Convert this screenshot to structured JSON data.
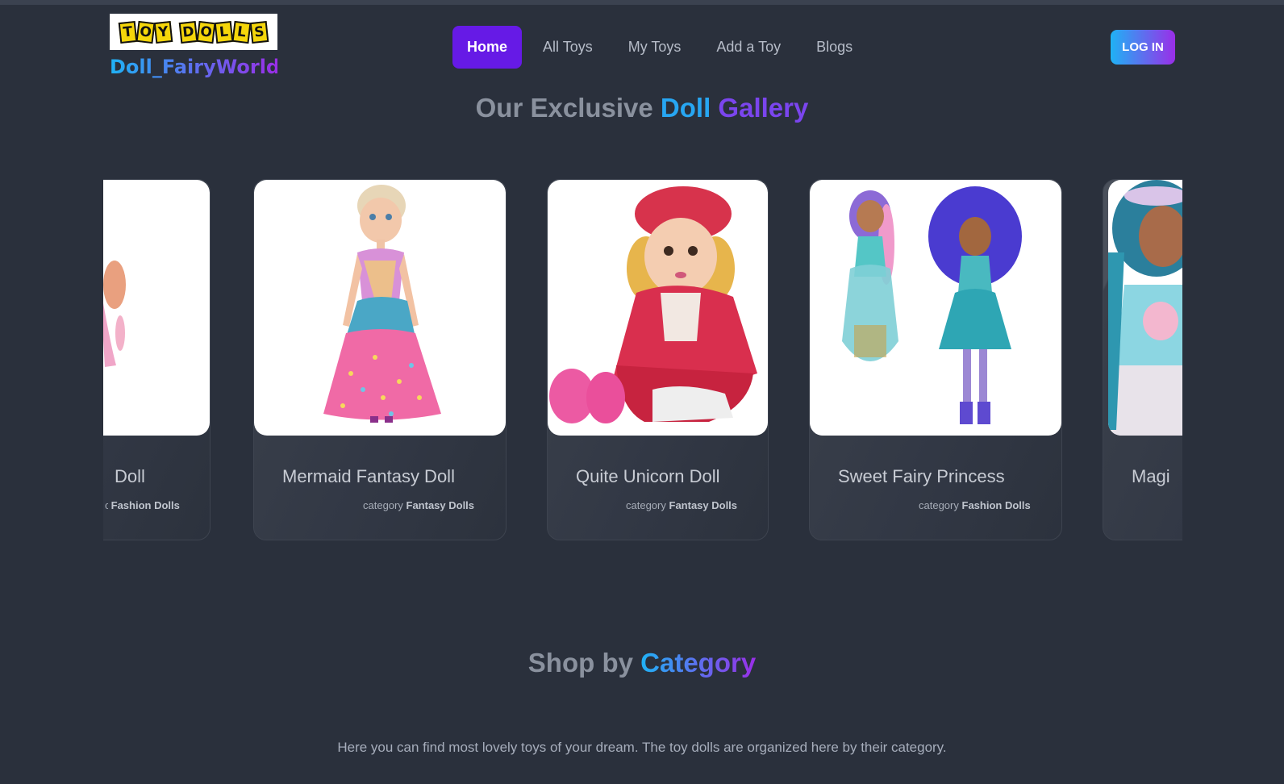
{
  "header": {
    "logo_letters_1": [
      "T",
      "O",
      "Y"
    ],
    "logo_letters_2": [
      "D",
      "O",
      "L",
      "L",
      "S"
    ],
    "brand_name": "Doll_FairyWorld",
    "nav": [
      "Home",
      "All Toys",
      "My Toys",
      "Add a Toy",
      "Blogs"
    ],
    "login_label": "LOG IN"
  },
  "gallery": {
    "title_plain": "Our Exclusive",
    "title_accent_1": "Doll",
    "title_accent_2": "Gallery",
    "category_prefix": "category",
    "cards": [
      {
        "title": "Doll",
        "category": "Fashion Dolls",
        "image": "pink-dress-doll"
      },
      {
        "title": "Mermaid Fantasy Doll",
        "category": "Fantasy Dolls",
        "image": "rainbow-princess-doll"
      },
      {
        "title": "Quite Unicorn Doll",
        "category": "Fantasy Dolls",
        "image": "red-coat-baby-doll"
      },
      {
        "title": "Sweet Fairy Princess",
        "category": "Fashion Dolls",
        "image": "purple-hair-fairy-dolls"
      },
      {
        "title": "Magi",
        "category": "",
        "image": "mermaid-tee-doll"
      }
    ]
  },
  "category_section": {
    "title_plain": "Shop by",
    "title_accent": "Category",
    "description": "Here you can find most lovely toys of your dream. The toy dolls are organized here by their category."
  },
  "colors": {
    "background": "#2a303c",
    "primary": "#661ae6",
    "gradient_start": "#1fb2f5",
    "gradient_end": "#9a2ee8"
  }
}
